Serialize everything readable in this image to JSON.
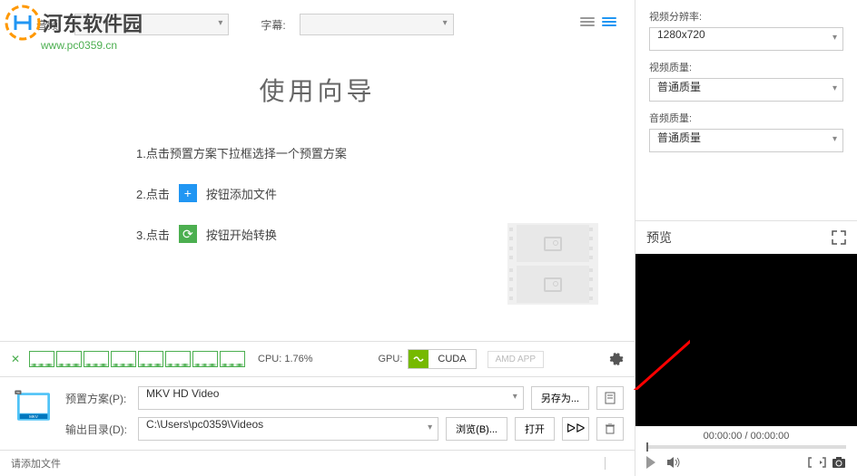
{
  "watermark": {
    "site_name": "河东软件园",
    "url": "www.pc0359.cn"
  },
  "top_bar": {
    "audio_label": "音频:",
    "subtitle_label": "字幕:"
  },
  "wizard": {
    "title": "使用向导",
    "step1": "1.点击预置方案下拉框选择一个预置方案",
    "step2_prefix": "2.点击",
    "step2_suffix": "按钮添加文件",
    "step3_prefix": "3.点击",
    "step3_suffix": "按钮开始转换"
  },
  "perf": {
    "cpu_label": "CPU: 1.76%",
    "gpu_label": "GPU:",
    "cuda": "CUDA",
    "amd": "AMD APP"
  },
  "preset": {
    "scheme_label": "预置方案(P):",
    "scheme_value": "MKV HD Video",
    "output_label": "输出目录(D):",
    "output_value": "C:\\Users\\pc0359\\Videos",
    "saveas": "另存为...",
    "browse": "浏览(B)...",
    "open": "打开"
  },
  "status": {
    "add_file": "请添加文件"
  },
  "settings": {
    "resolution_label": "视频分辨率:",
    "resolution_value": "1280x720",
    "video_quality_label": "视频质量:",
    "video_quality_value": "普通质量",
    "audio_quality_label": "音频质量:",
    "audio_quality_value": "普通质量"
  },
  "preview": {
    "title": "预览",
    "time": "00:00:00 / 00:00:00"
  }
}
